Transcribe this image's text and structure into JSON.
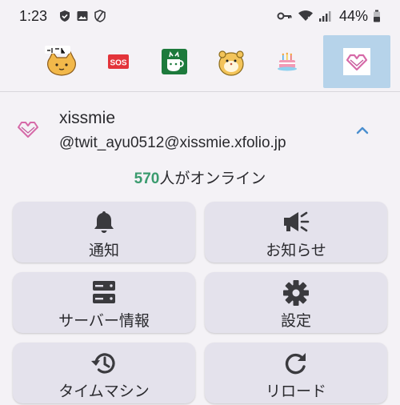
{
  "status_bar": {
    "time": "1:23",
    "battery": "44%",
    "icons": [
      "shield-check-icon",
      "image-icon",
      "shield-off-icon",
      "key-icon",
      "wifi-icon",
      "signal-icon",
      "battery-icon"
    ]
  },
  "tabs": [
    {
      "name": "cat-emoji",
      "selected": false
    },
    {
      "name": "sos-emoji",
      "label": "SOS",
      "selected": false
    },
    {
      "name": "green-cup-emoji",
      "selected": false
    },
    {
      "name": "hamster-emoji",
      "selected": false
    },
    {
      "name": "cake-emoji",
      "selected": false
    },
    {
      "name": "xissmie-heart-logo",
      "selected": true
    }
  ],
  "account": {
    "name": "xissmie",
    "handle": "@twit_ayu0512@xissmie.xfolio.jp"
  },
  "online": {
    "count": "570",
    "suffix": "人がオンライン"
  },
  "menu": [
    {
      "id": "notifications",
      "label": "通知",
      "icon": "bell-icon"
    },
    {
      "id": "announcements",
      "label": "お知らせ",
      "icon": "megaphone-icon"
    },
    {
      "id": "server-info",
      "label": "サーバー情報",
      "icon": "server-icon"
    },
    {
      "id": "settings",
      "label": "設定",
      "icon": "gear-icon"
    },
    {
      "id": "time-machine",
      "label": "タイムマシン",
      "icon": "history-icon"
    },
    {
      "id": "reload",
      "label": "リロード",
      "icon": "reload-icon"
    }
  ],
  "colors": {
    "background": "#f4f2f6",
    "button": "#e4e2ec",
    "selected_tab": "#b6d3ea",
    "online_count": "#3a9b6e",
    "brand_heart": "#d66aa8",
    "collapse_chevron": "#4a8fcf"
  }
}
